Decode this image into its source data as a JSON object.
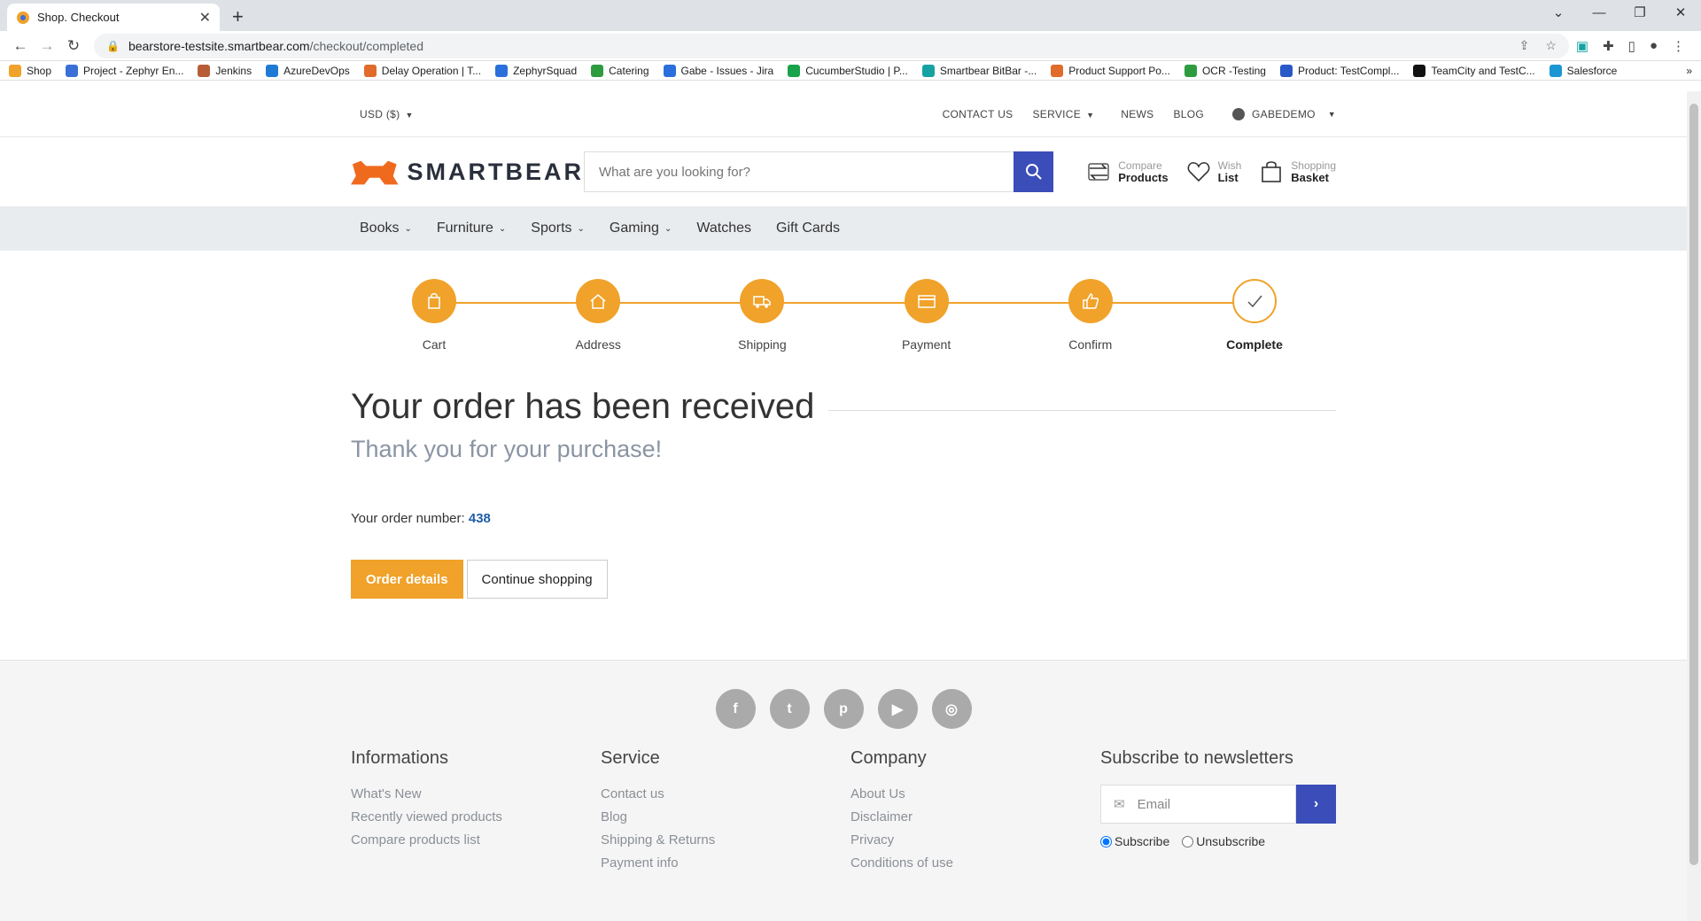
{
  "browser": {
    "tab_title": "Shop. Checkout",
    "new_tab": "+",
    "url_host": "bearstore-testsite.smartbear.com",
    "url_path": "/checkout/completed",
    "bookmarks": [
      {
        "label": "Shop",
        "color": "#f0a22a"
      },
      {
        "label": "Project - Zephyr En...",
        "color": "#3b6fd8"
      },
      {
        "label": "Jenkins",
        "color": "#b85c38"
      },
      {
        "label": "AzureDevOps",
        "color": "#1f7ad6"
      },
      {
        "label": "Delay Operation | T...",
        "color": "#e06b2a"
      },
      {
        "label": "ZephyrSquad",
        "color": "#2a6fdb"
      },
      {
        "label": "Catering",
        "color": "#2c9c3f"
      },
      {
        "label": "Gabe - Issues - Jira",
        "color": "#2a6fdb"
      },
      {
        "label": "CucumberStudio | P...",
        "color": "#18a34a"
      },
      {
        "label": "Smartbear BitBar -...",
        "color": "#17a2a2"
      },
      {
        "label": "Product Support Po...",
        "color": "#e06b2a"
      },
      {
        "label": "OCR -Testing",
        "color": "#2c9c3f"
      },
      {
        "label": "Product: TestCompl...",
        "color": "#2a58c8"
      },
      {
        "label": "TeamCity and TestC...",
        "color": "#111111"
      },
      {
        "label": "Salesforce",
        "color": "#1b96d4"
      }
    ],
    "bookmarks_more": "»"
  },
  "topbar": {
    "currency": "USD  ($)",
    "contact": "CONTACT US",
    "service": "SERVICE",
    "news": "NEWS",
    "blog": "BLOG",
    "user": "GABEDEMO"
  },
  "header": {
    "logo_text": "SMARTBEAR",
    "search_placeholder": "What are you looking for?",
    "compare_sub": "Compare",
    "compare_main": "Products",
    "wish_sub": "Wish",
    "wish_main": "List",
    "basket_sub": "Shopping",
    "basket_main": "Basket"
  },
  "menu": [
    {
      "label": "Books",
      "dropdown": true
    },
    {
      "label": "Furniture",
      "dropdown": true
    },
    {
      "label": "Sports",
      "dropdown": true
    },
    {
      "label": "Gaming",
      "dropdown": true
    },
    {
      "label": "Watches",
      "dropdown": false
    },
    {
      "label": "Gift Cards",
      "dropdown": false
    }
  ],
  "steps": [
    {
      "label": "Cart",
      "icon": "cart-icon"
    },
    {
      "label": "Address",
      "icon": "home-icon"
    },
    {
      "label": "Shipping",
      "icon": "truck-icon"
    },
    {
      "label": "Payment",
      "icon": "credit-card-icon"
    },
    {
      "label": "Confirm",
      "icon": "thumbs-up-icon"
    },
    {
      "label": "Complete",
      "icon": "check-icon"
    }
  ],
  "main": {
    "title": "Your order has been received",
    "subtitle": "Thank you for your purchase!",
    "order_label": "Your order number:",
    "order_number": "438",
    "order_details_button": "Order details",
    "continue_button": "Continue shopping"
  },
  "footer": {
    "social": [
      "f",
      "t",
      "p",
      "▶",
      "◎"
    ],
    "informations_title": "Informations",
    "informations": [
      "What's New",
      "Recently viewed products",
      "Compare products list"
    ],
    "service_title": "Service",
    "service": [
      "Contact us",
      "Blog",
      "Shipping & Returns",
      "Payment info"
    ],
    "company_title": "Company",
    "company": [
      "About Us",
      "Disclaimer",
      "Privacy",
      "Conditions of use"
    ],
    "newsletter_title": "Subscribe to newsletters",
    "email_placeholder": "Email",
    "subscribe": "Subscribe",
    "unsubscribe": "Unsubscribe"
  },
  "colors": {
    "accent": "#f0a22a",
    "primary": "#3b4db8",
    "link": "#1f5ea8"
  }
}
